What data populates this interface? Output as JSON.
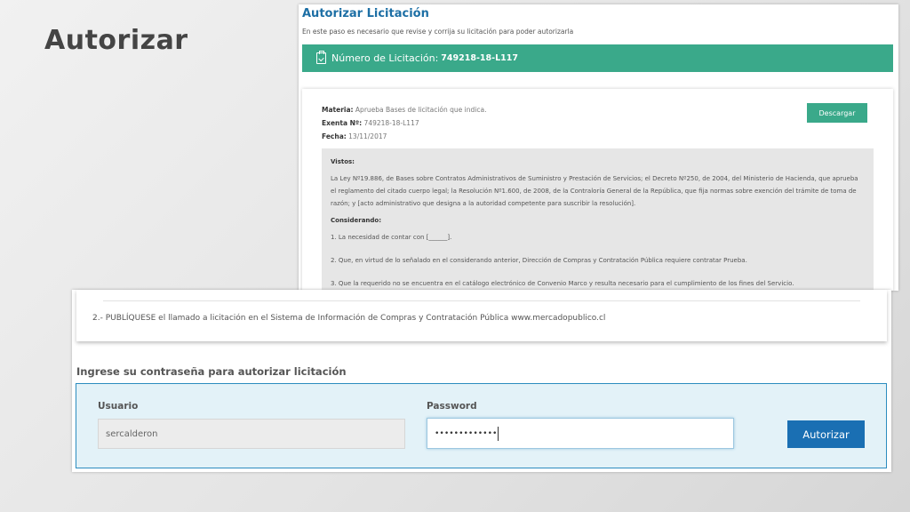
{
  "slide": {
    "title": "Autorizar"
  },
  "page": {
    "title": "Autorizar Licitación",
    "subtitle": "En este paso es necesario que revise y corrija su licitación para poder autorizarla"
  },
  "numero": {
    "label": "Número de Licitación:",
    "value": "749218-18-L117",
    "icon": "clipboard-check-icon"
  },
  "document": {
    "materia_label": "Materia:",
    "materia_value": "Aprueba Bases de licitación que indica.",
    "exenta_label": "Exenta Nº:",
    "exenta_value": "749218-18-L117",
    "fecha_label": "Fecha:",
    "fecha_value": "13/11/2017",
    "download_label": "Descargar",
    "vistos_heading": "Vistos:",
    "vistos_text": "La Ley Nº19.886, de Bases sobre Contratos Administrativos de Suministro y Prestación de Servicios; el Decreto Nº250, de 2004, del Ministerio de Hacienda, que aprueba el reglamento del citado cuerpo legal; la Resolución Nº1.600, de 2008, de la Contraloría General de la República, que fija normas sobre exención del trámite de toma de razón; y [acto administrativo que designa a la autoridad competente para suscribir la resolución].",
    "considerando_heading": "Considerando:",
    "considerando_1": "1. La necesidad de contar con [______].",
    "considerando_2": "2. Que, en virtud de lo señalado en el considerando anterior, Dirección de Compras y Contratación Pública requiere contratar Prueba.",
    "considerando_3": "3. Que la requerido no se encuentra en el catálogo electrónico de Convenio Marco y resulta necesario para el cumplimiento de los fines del Servicio."
  },
  "publiquese": {
    "text": "2.- PUBLÍQUESE el llamado a licitación en el Sistema de Información de Compras y Contratación Pública www.mercadopublico.cl"
  },
  "auth": {
    "title": "Ingrese su contraseña para autorizar licitación",
    "usuario_label": "Usuario",
    "usuario_value": "sercalderon",
    "password_label": "Password",
    "password_value": "•••••••••••••",
    "button_label": "Autorizar"
  },
  "colors": {
    "accent_green": "#3aa98a",
    "title_blue": "#1d6fa5",
    "button_blue": "#1a6fb3",
    "auth_bg": "#e3f2f8"
  }
}
